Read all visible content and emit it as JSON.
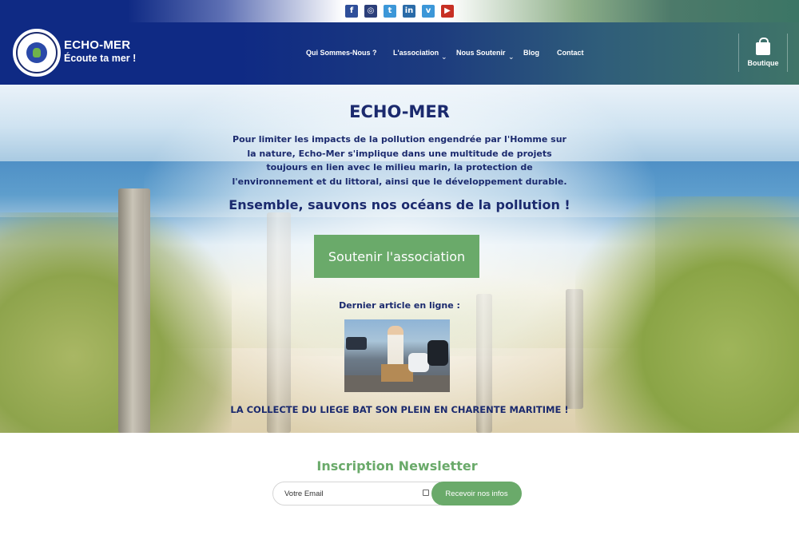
{
  "social": {
    "items": [
      {
        "name": "facebook",
        "glyph": "f",
        "color": "#2f4f9a"
      },
      {
        "name": "instagram",
        "glyph": "◎",
        "color": "#2c3f7a"
      },
      {
        "name": "twitter",
        "glyph": "t",
        "color": "#3c97d8"
      },
      {
        "name": "linkedin",
        "glyph": "in",
        "color": "#2a6ba8"
      },
      {
        "name": "vimeo",
        "glyph": "v",
        "color": "#3c97d8"
      },
      {
        "name": "youtube",
        "glyph": "▶",
        "color": "#c73024"
      }
    ]
  },
  "brand": {
    "name": "ECHO-MER",
    "tagline": "Écoute ta mer !"
  },
  "nav": {
    "items": [
      {
        "label": "Qui Sommes-Nous ?",
        "has_dropdown": false
      },
      {
        "label": "L'association",
        "has_dropdown": true
      },
      {
        "label": "Nous Soutenir",
        "has_dropdown": true
      },
      {
        "label": "Blog",
        "has_dropdown": false
      },
      {
        "label": "Contact",
        "has_dropdown": false
      }
    ],
    "caret": "⌄"
  },
  "shop": {
    "label": "Boutique",
    "icon": "shopping-bag-icon"
  },
  "hero": {
    "title": "ECHO-MER",
    "text": "Pour limiter les impacts de la pollution engendrée par l'Homme sur la nature, Echo-Mer s'implique dans une multitude de projets toujours en lien avec le milieu marin, la protection de l'environnement et du littoral, ainsi que le développement durable.",
    "slogan": "Ensemble, sauvons nos océans de la pollution !",
    "button_label": "Soutenir l'association",
    "last_article_label": "Dernier article en ligne :",
    "article_title": "LA COLLECTE DU LIEGE BAT SON PLEIN EN CHARENTE MARITIME !"
  },
  "newsletter": {
    "title": "Inscription Newsletter",
    "placeholder": "Votre Email",
    "button_label": "Recevoir nos infos"
  },
  "colors": {
    "navy": "#0f2a84",
    "heading": "#1b2a6e",
    "green_accent": "#6aaa6a"
  }
}
